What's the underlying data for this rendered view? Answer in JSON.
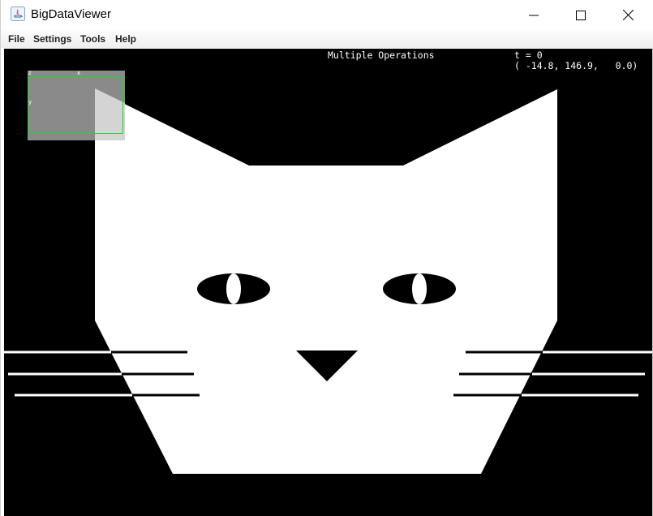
{
  "window": {
    "title": "BigDataViewer",
    "controls": [
      "minimize-icon",
      "maximize-icon",
      "close-icon"
    ]
  },
  "menu": {
    "items": [
      {
        "label": "File"
      },
      {
        "label": "Settings"
      },
      {
        "label": "Tools"
      },
      {
        "label": "Help"
      }
    ]
  },
  "viewer": {
    "source_name": "Multiple Operations",
    "timepoint": "t = 0",
    "coordinates": "( -14.8, 146.9,   0.0)",
    "navigator": {
      "axis_z": "z",
      "axis_x": "x",
      "axis_y": "y"
    },
    "image_content": "cat-face",
    "colors": {
      "background": "#000000",
      "foreground": "#ffffff",
      "navigator_box": "#2bd22b"
    }
  }
}
